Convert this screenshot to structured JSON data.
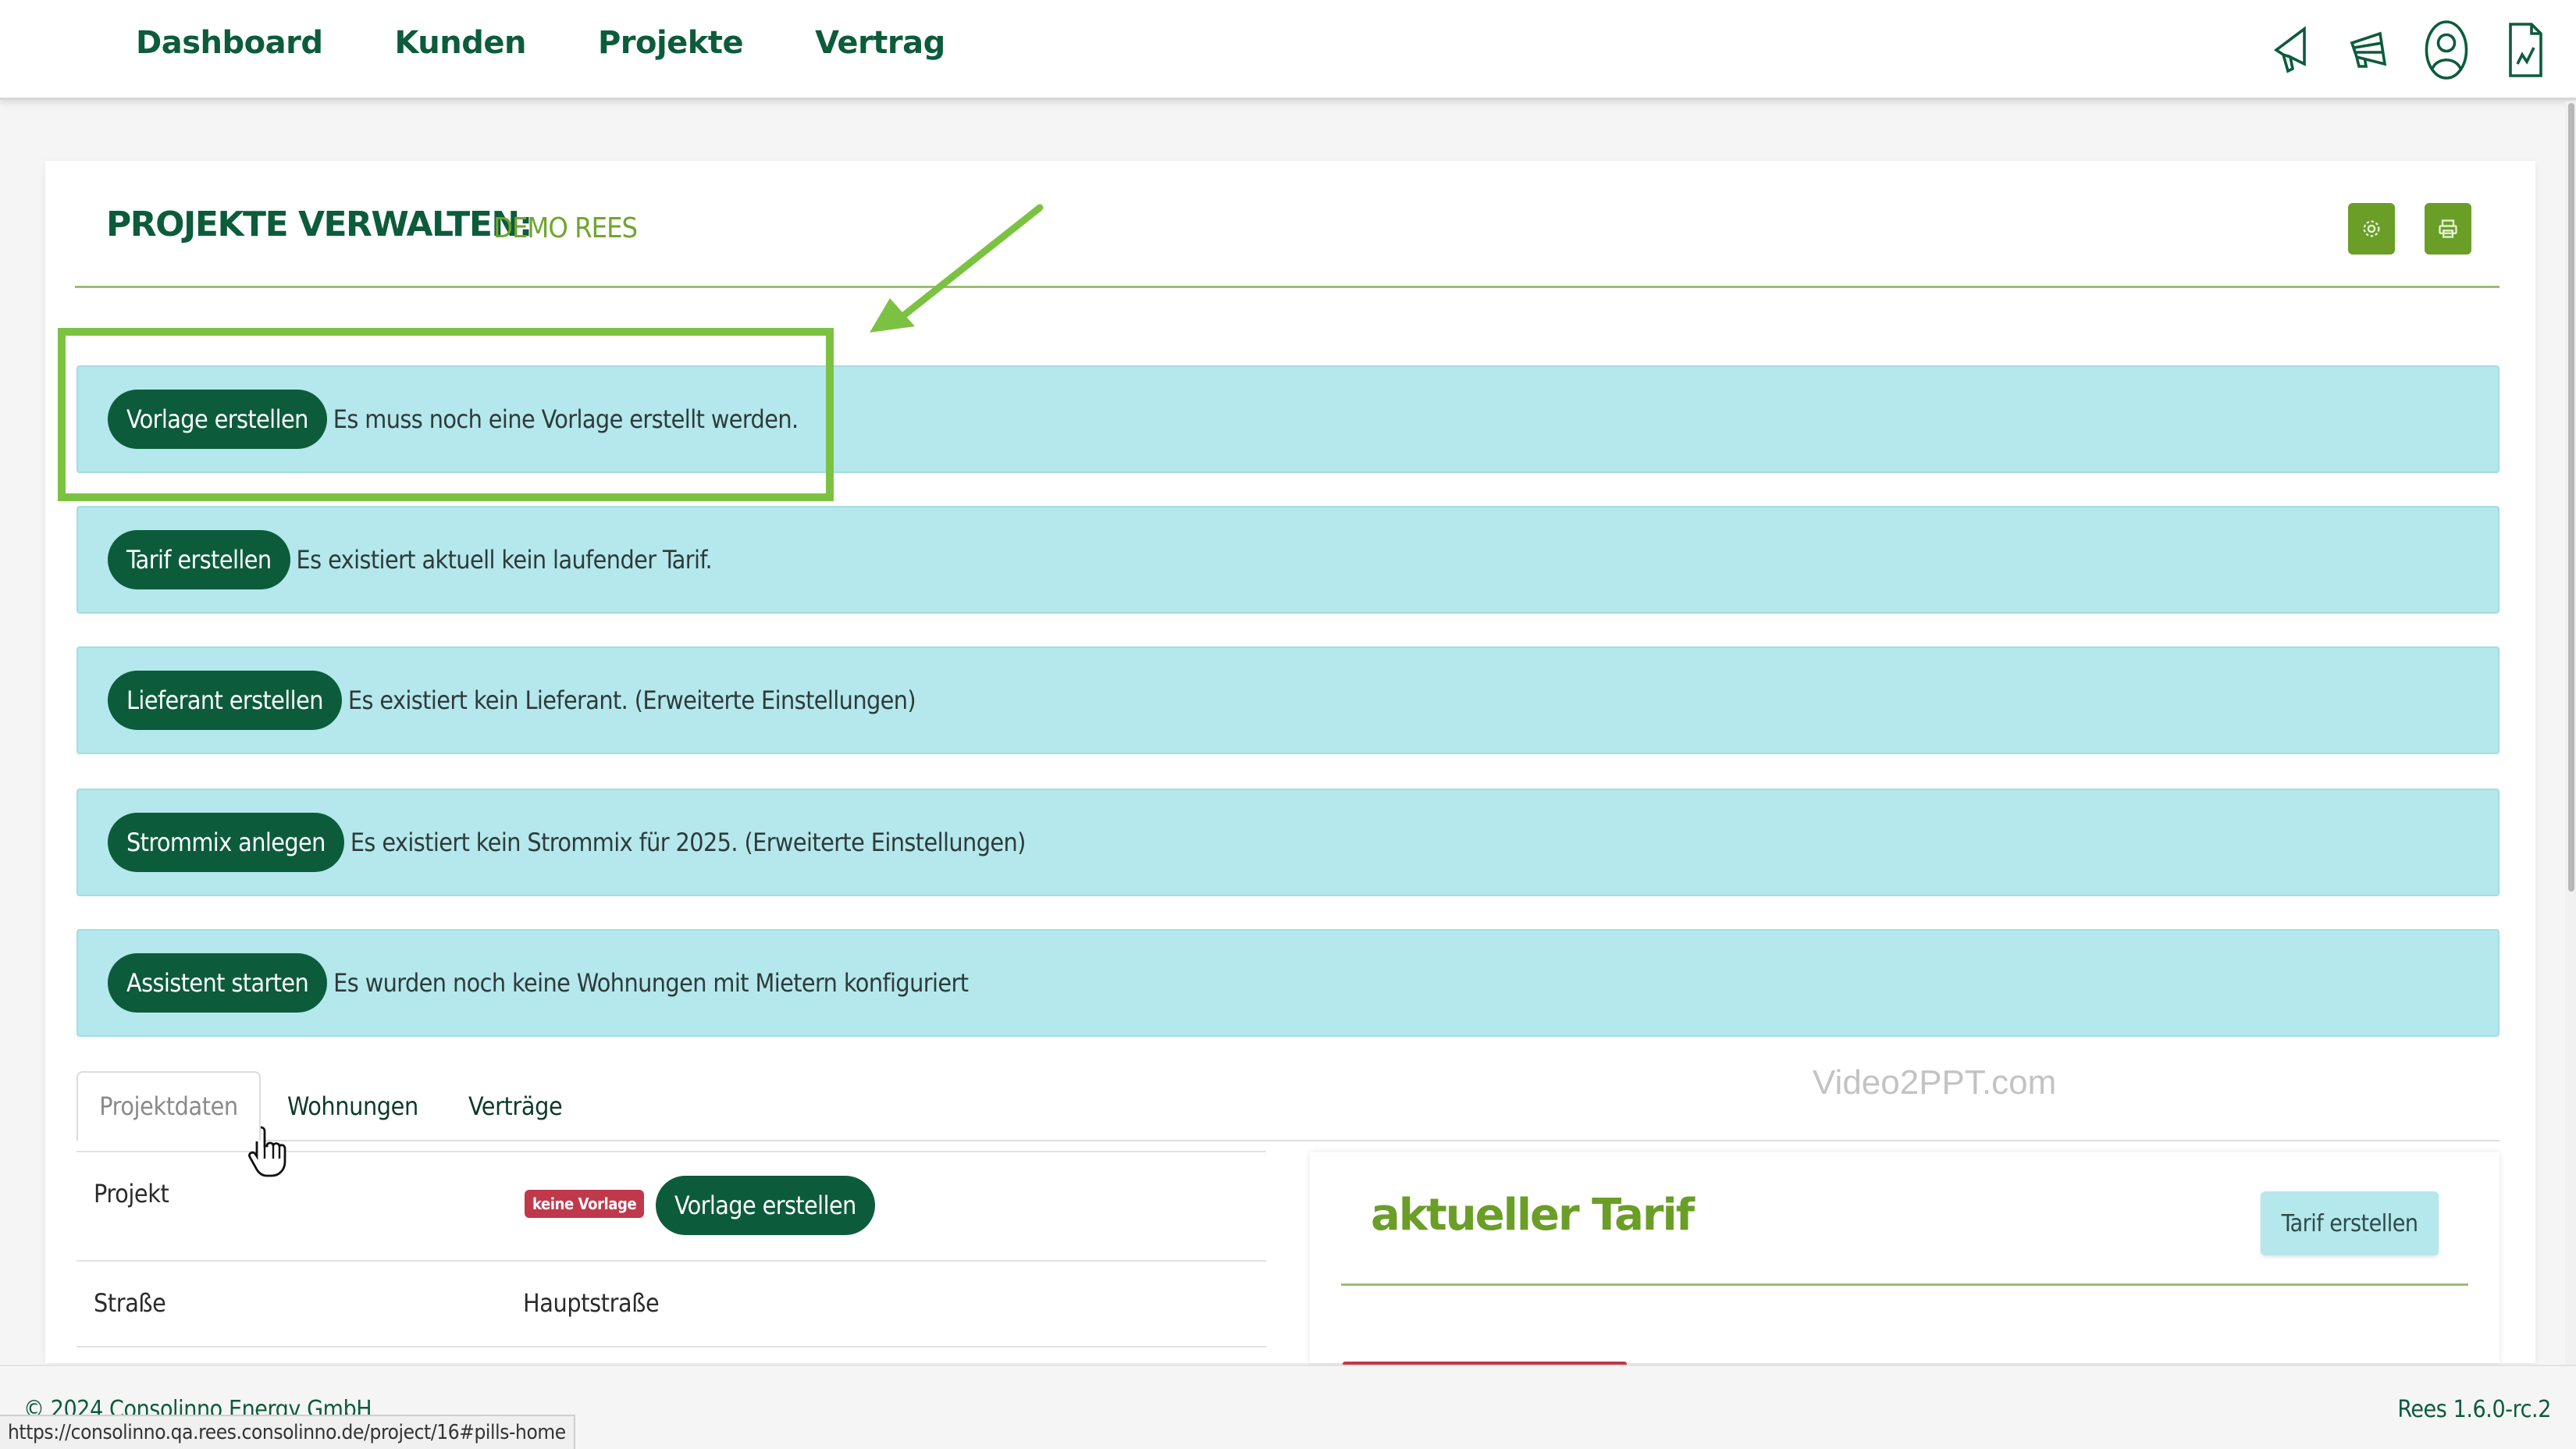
{
  "nav": {
    "items": [
      "Dashboard",
      "Kunden",
      "Projekte",
      "Vertrag"
    ]
  },
  "top_icons": [
    "megaphone-icon",
    "broadcast-icon",
    "user-icon",
    "document-icon"
  ],
  "header": {
    "title": "PROJEKTE VERWALTEN:",
    "subtitle": "DEMO REES",
    "buttons": [
      "settings-icon",
      "print-icon"
    ]
  },
  "alerts": [
    {
      "button": "Vorlage erstellen",
      "text": "Es muss noch eine Vorlage erstellt werden."
    },
    {
      "button": "Tarif erstellen",
      "text": "Es existiert aktuell kein laufender Tarif."
    },
    {
      "button": "Lieferant erstellen",
      "text": "Es existiert kein Lieferant. (Erweiterte Einstellungen)"
    },
    {
      "button": "Strommix anlegen",
      "text": "Es existiert kein Strommix für 2025. (Erweiterte Einstellungen)"
    },
    {
      "button": "Assistent starten",
      "text": "Es wurden noch keine Wohnungen mit Mietern konfiguriert"
    }
  ],
  "tabs": [
    {
      "label": "Projektdaten",
      "active": true
    },
    {
      "label": "Wohnungen",
      "active": false
    },
    {
      "label": "Verträge",
      "active": false
    }
  ],
  "watermark": "Video2PPT.com",
  "project_table": {
    "rows": [
      {
        "label": "Projekt",
        "badge": "keine Vorlage",
        "button": "Vorlage erstellen"
      },
      {
        "label": "Straße",
        "value": "Hauptstraße"
      }
    ]
  },
  "tarif_panel": {
    "title": "aktueller Tarif",
    "button": "Tarif erstellen"
  },
  "footer": {
    "copyright": "© 2024 Consolinno Energy GmbH",
    "version": "Rees 1.6.0-rc.2",
    "status_url": "https://consolinno.qa.rees.consolinno.de/project/16#pills-home"
  },
  "colors": {
    "brand_dark": "#0c5c3c",
    "brand_green": "#6a9e27",
    "alert_bg": "#b4e8ec",
    "highlight": "#7cc242",
    "badge_red": "#c0384b"
  }
}
